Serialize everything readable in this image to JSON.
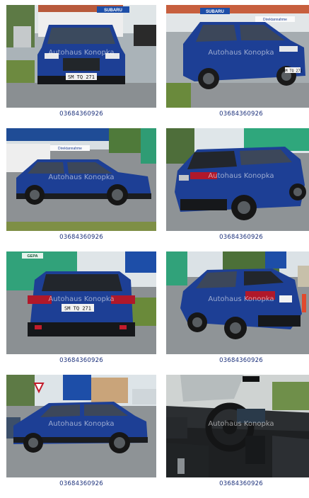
{
  "watermark": "Autohaus Konopka",
  "car_color": "#1d3f95",
  "photos": [
    {
      "view": "front",
      "plate": "SM TQ 271",
      "id_label": "03684360926"
    },
    {
      "view": "front-right",
      "plate": "SM TQ 271",
      "id_label": "03684360926"
    },
    {
      "view": "side-right",
      "plate": "",
      "id_label": "03684360926"
    },
    {
      "view": "rear-left",
      "plate": "",
      "id_label": "03684360926"
    },
    {
      "view": "rear",
      "plate": "SM TQ 271",
      "id_label": "03684360926"
    },
    {
      "view": "rear-right",
      "plate": "",
      "id_label": "03684360926"
    },
    {
      "view": "side-left",
      "plate": "",
      "id_label": "03684360926"
    },
    {
      "view": "interior",
      "plate": "",
      "id_label": "03684360926"
    }
  ],
  "signs": {
    "subaru": "SUBARU",
    "dealer": "Direktannahme",
    "fuel": "GEPA"
  }
}
